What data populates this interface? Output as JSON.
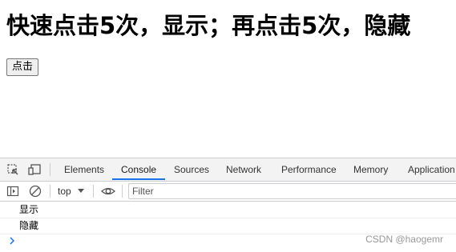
{
  "page": {
    "heading": "快速点击5次，显示；再点击5次，隐藏",
    "button_label": "点击"
  },
  "devtools": {
    "tabs": [
      {
        "label": "Elements"
      },
      {
        "label": "Console"
      },
      {
        "label": "Sources"
      },
      {
        "label": "Network"
      },
      {
        "label": "Performance"
      },
      {
        "label": "Memory"
      },
      {
        "label": "Application"
      }
    ],
    "active_tab": "Console",
    "context": "top",
    "filter_placeholder": "Filter",
    "console_lines": [
      "显示",
      "隐藏"
    ],
    "accent_color": "#1a73e8"
  },
  "watermark": "CSDN @haogemr"
}
